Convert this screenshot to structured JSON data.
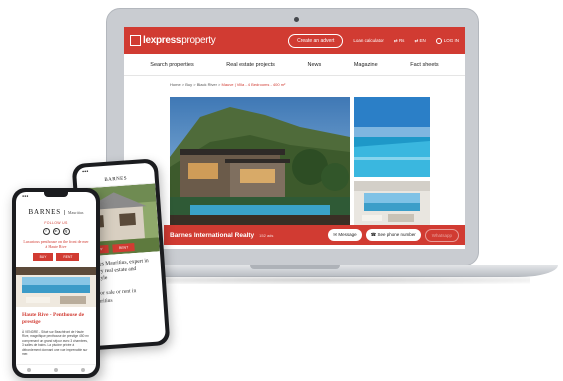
{
  "site": {
    "logo": "lexpress",
    "logo_light": "property",
    "create_advert": "Create an advert",
    "loan_calc": "Loan calculator",
    "currency": "Rs",
    "lang": "EN",
    "login": "LOG IN"
  },
  "nav": [
    "Search properties",
    "Real estate projects",
    "News",
    "Magazine",
    "Fact sheets"
  ],
  "breadcrumb": {
    "home": "Home",
    "buy": "Buy",
    "loc": "Black River",
    "current": "Mauve | Villa - 4 Bedrooms - 400 m²"
  },
  "agent_bar": {
    "name": "Barnes International Realty",
    "count": "152 ads",
    "message": "Message",
    "phone": "See phone number",
    "ghost": "Whatsapp"
  },
  "phone_back": {
    "brand": "BARNES",
    "btn1": "BUY",
    "btn2": "RENT",
    "text1": "Barnes Mauritius, expert in luxury real estate and lifestyle",
    "text2": "sty for sale or rent in Mauritius"
  },
  "phone_front": {
    "brand_main": "BARNES",
    "brand_sub": "Mauritius",
    "follow": "FOLLOW US",
    "socials": [
      "f",
      "in",
      "ig"
    ],
    "headline": "Luxurious penthouse on the front de mer à Haute Rive",
    "btn1": "BUY",
    "btn2": "RENT",
    "title": "Haute Rive - Penthouse de prestige",
    "body": "À VENDRE - Situé sur Beachfront de Haute Rive, magnifique penthouse de prestige 450 m² comprenant un grand séjour avec 3 chambres, 3 salles de bains. La piscine privée à débordement donnant une vue imprenable sur mer."
  }
}
